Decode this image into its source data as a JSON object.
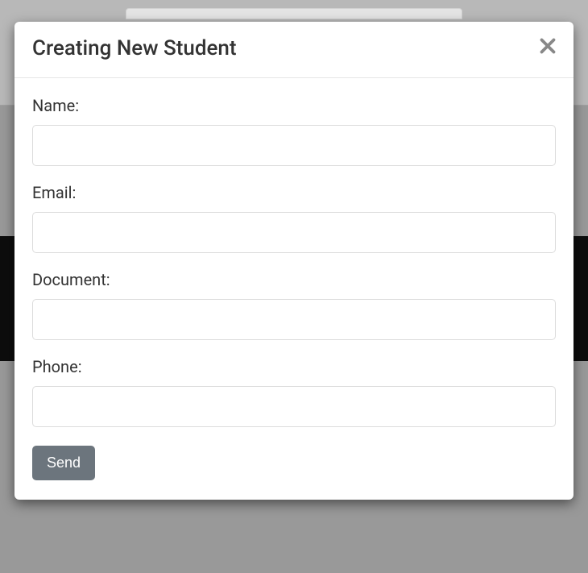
{
  "modal": {
    "title": "Creating New Student",
    "close_icon": "close",
    "form": {
      "fields": [
        {
          "label": "Name:",
          "value": ""
        },
        {
          "label": "Email:",
          "value": ""
        },
        {
          "label": "Document:",
          "value": ""
        },
        {
          "label": "Phone:",
          "value": ""
        }
      ],
      "submit_label": "Send"
    }
  }
}
